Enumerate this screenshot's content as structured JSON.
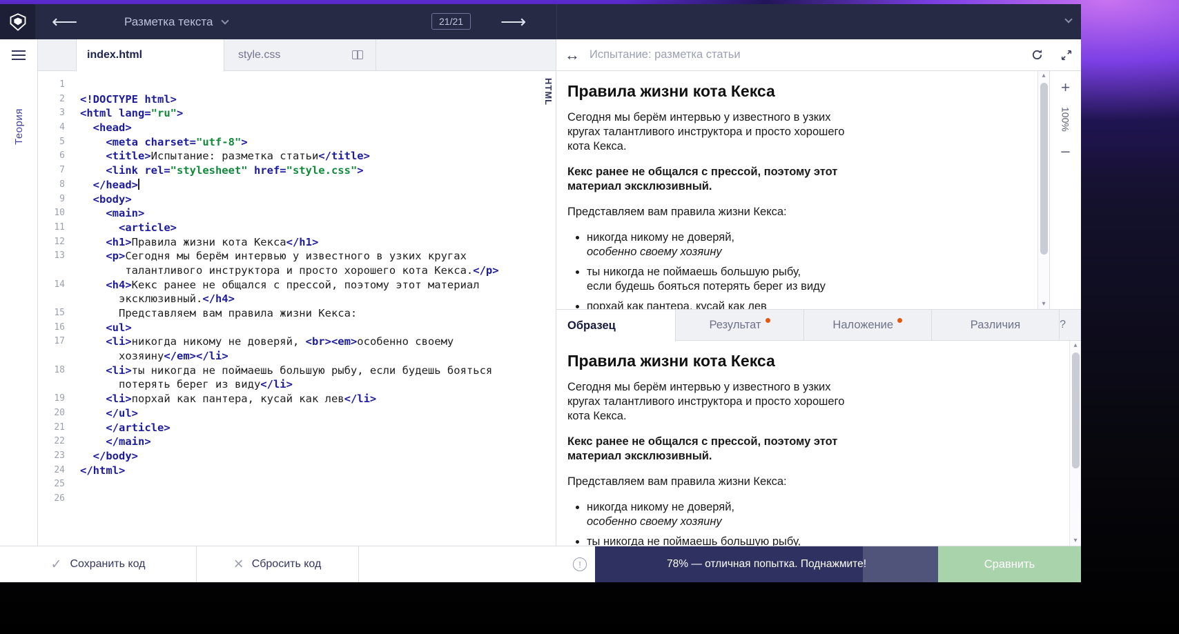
{
  "topbar": {
    "course_title": "Разметка текста",
    "progress_badge": "21/21"
  },
  "sidebar": {
    "theory_label": "Теория"
  },
  "editor": {
    "tabs": [
      {
        "label": "index.html"
      },
      {
        "label": "style.css"
      }
    ],
    "language_label": "HTML",
    "code_lines": [
      {
        "n": "1",
        "parts": []
      },
      {
        "n": "2",
        "parts": [
          [
            "t",
            "<!DOCTYPE html>"
          ]
        ]
      },
      {
        "n": "3",
        "parts": [
          [
            "t",
            "<html lang="
          ],
          [
            "s",
            "\"ru\""
          ],
          [
            "t",
            ">"
          ]
        ]
      },
      {
        "n": "4",
        "parts": [
          [
            "t",
            "  <head>"
          ]
        ]
      },
      {
        "n": "5",
        "parts": [
          [
            "t",
            "    <meta charset="
          ],
          [
            "s",
            "\"utf-8\""
          ],
          [
            "t",
            ">"
          ]
        ]
      },
      {
        "n": "6",
        "parts": [
          [
            "t",
            "    <title>"
          ],
          [
            "x",
            "Испытание: разметка статьи"
          ],
          [
            "t",
            "</title>"
          ]
        ]
      },
      {
        "n": "7",
        "parts": [
          [
            "t",
            "    <link rel="
          ],
          [
            "s",
            "\"stylesheet\""
          ],
          [
            "t",
            " href="
          ],
          [
            "s",
            "\"style.css\""
          ],
          [
            "t",
            ">"
          ]
        ]
      },
      {
        "n": "8",
        "parts": [
          [
            "t",
            "  </head>"
          ],
          [
            "caret",
            ""
          ]
        ]
      },
      {
        "n": "9",
        "parts": [
          [
            "t",
            "  <body>"
          ]
        ]
      },
      {
        "n": "10",
        "parts": [
          [
            "t",
            "    <main>"
          ]
        ]
      },
      {
        "n": "11",
        "parts": [
          [
            "t",
            "      <article>"
          ]
        ]
      },
      {
        "n": "12",
        "parts": [
          [
            "t",
            "    <h1>"
          ],
          [
            "x",
            "Правила жизни кота Кекса"
          ],
          [
            "t",
            "</h1>"
          ]
        ]
      },
      {
        "n": "13",
        "parts": [
          [
            "t",
            "    <p>"
          ],
          [
            "x",
            "Сегодня мы берём интервью у известного в узких кругах"
          ]
        ]
      },
      {
        "n": "",
        "parts": [
          [
            "x",
            "       талантливого инструктора и просто хорошего кота Кекса."
          ],
          [
            "t",
            "</p>"
          ]
        ]
      },
      {
        "n": "14",
        "parts": [
          [
            "t",
            "    <h4>"
          ],
          [
            "x",
            "Кекс ранее не общался с прессой, поэтому этот материал"
          ]
        ]
      },
      {
        "n": "",
        "parts": [
          [
            "x",
            "      эксклюзивный."
          ],
          [
            "t",
            "</h4>"
          ]
        ]
      },
      {
        "n": "15",
        "parts": [
          [
            "x",
            "      Представляем вам правила жизни Кекса:"
          ]
        ]
      },
      {
        "n": "16",
        "parts": [
          [
            "t",
            "    <ul>"
          ]
        ]
      },
      {
        "n": "17",
        "parts": [
          [
            "t",
            "    <li>"
          ],
          [
            "x",
            "никогда никому не доверяй, "
          ],
          [
            "t",
            "<br><em>"
          ],
          [
            "x",
            "особенно своему"
          ]
        ]
      },
      {
        "n": "",
        "parts": [
          [
            "x",
            "      хозяину"
          ],
          [
            "t",
            "</em></li>"
          ]
        ]
      },
      {
        "n": "18",
        "parts": [
          [
            "t",
            "    <li>"
          ],
          [
            "x",
            "ты никогда не поймаешь большую рыбу, если будешь бояться"
          ]
        ]
      },
      {
        "n": "",
        "parts": [
          [
            "x",
            "      потерять берег из виду"
          ],
          [
            "t",
            "</li>"
          ]
        ]
      },
      {
        "n": "19",
        "parts": [
          [
            "t",
            "    <li>"
          ],
          [
            "x",
            "порхай как пантера, кусай как лев"
          ],
          [
            "t",
            "</li>"
          ]
        ]
      },
      {
        "n": "20",
        "parts": [
          [
            "t",
            "    </ul>"
          ]
        ]
      },
      {
        "n": "21",
        "parts": [
          [
            "t",
            "    </article>"
          ]
        ]
      },
      {
        "n": "22",
        "parts": [
          [
            "t",
            "    </main>"
          ]
        ]
      },
      {
        "n": "23",
        "parts": [
          [
            "t",
            "  </body>"
          ]
        ]
      },
      {
        "n": "24",
        "parts": [
          [
            "t",
            "</html>"
          ]
        ]
      },
      {
        "n": "25",
        "parts": []
      },
      {
        "n": "26",
        "parts": []
      }
    ]
  },
  "preview": {
    "url_text": "Испытание: разметка статьи",
    "zoom": {
      "plus": "+",
      "level": "100%",
      "minus": "–"
    }
  },
  "sample": {
    "tabs": [
      {
        "label": "Образец",
        "dot": false
      },
      {
        "label": "Результат",
        "dot": true
      },
      {
        "label": "Наложение",
        "dot": true
      },
      {
        "label": "Различия",
        "dot": false
      }
    ],
    "help_label": "?"
  },
  "article": {
    "title": "Правила жизни кота Кекса",
    "intro": "Сегодня мы берём интервью у известного в узких кругах талантливого инструктора и просто хорошего кота Кекса.",
    "exclusive": "Кекс ранее не общался с прессой, поэтому этот материал эксклюзивный.",
    "rules_intro": "Представляем вам правила жизни Кекса:",
    "items": [
      {
        "text": "никогда никому не доверяй,",
        "em": "особенно своему хозяину"
      },
      {
        "text": "ты никогда не поймаешь большую рыбу, если будешь бояться потерять берег из виду",
        "em": ""
      },
      {
        "text": "порхай как пантера, кусай как лев",
        "em": ""
      }
    ]
  },
  "bottombar": {
    "save_label": "Сохранить код",
    "reset_label": "Сбросить код",
    "progress_percent": 78,
    "progress_text": "78% — отличная попытка. Поднажмите!",
    "compare_label": "Сравнить"
  }
}
